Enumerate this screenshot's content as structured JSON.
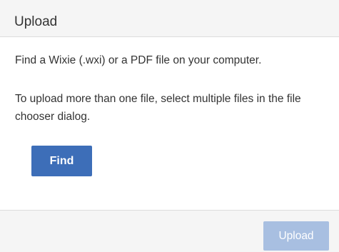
{
  "dialog": {
    "title": "Upload",
    "instruction_text": "Find a Wixie (.wxi) or a PDF file on your computer.",
    "multi_file_text": "To upload more than one file, select multiple files in the file chooser dialog.",
    "find_label": "Find",
    "upload_label": "Upload",
    "upload_disabled": true
  },
  "colors": {
    "header_bg": "#f5f5f5",
    "primary_button": "#3d6eb8",
    "disabled_button": "#a8bfe1",
    "text": "#333333",
    "divider": "#dcdcdc"
  }
}
